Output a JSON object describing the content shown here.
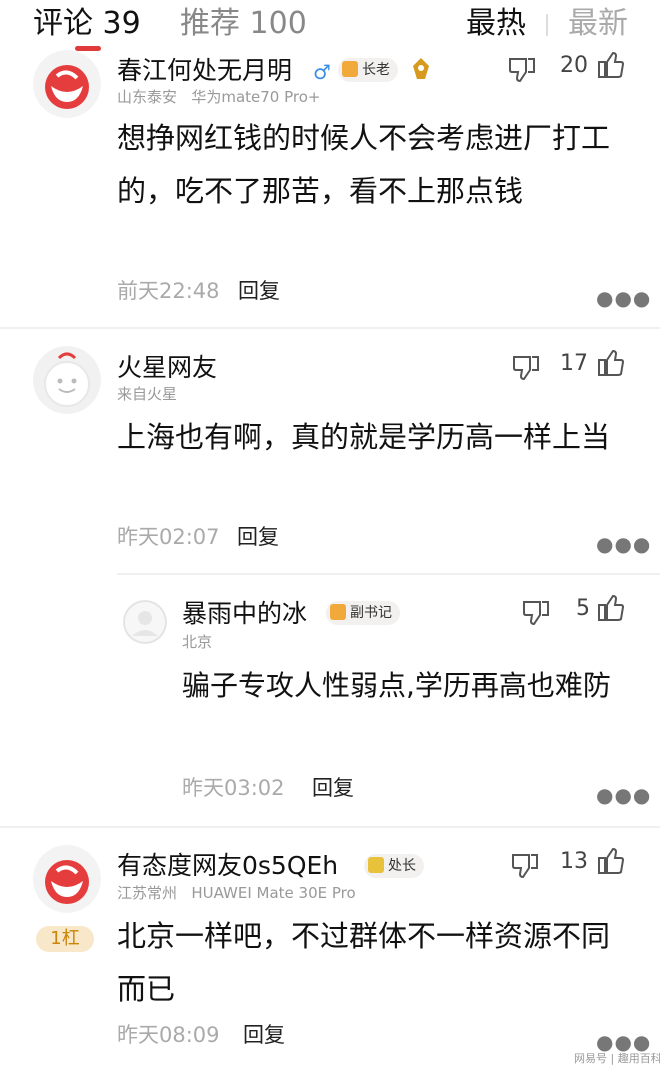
{
  "tabs": {
    "comments_label": "评论",
    "comments_count": "39",
    "recommend_label": "推荐",
    "recommend_count": "100"
  },
  "sort": {
    "hot": "最热",
    "latest": "最新"
  },
  "reply_label": "回复",
  "comments": [
    {
      "name": "春江何处无月明",
      "badge": "长老",
      "location": "山东泰安",
      "device": "华为mate70 Pro+",
      "text": "想挣网红钱的时候人不会考虑进厂打工的，吃不了那苦，看不上那点钱",
      "time": "前天22:48",
      "likes": "20"
    },
    {
      "name": "火星网友",
      "location": "来自火星",
      "text": "上海也有啊，真的就是学历高一样上当",
      "time": "昨天02:07",
      "likes": "17"
    },
    {
      "name": "暴雨中的冰",
      "badge": "副书记",
      "location": "北京",
      "text": "骗子专攻人性弱点,学历再高也难防",
      "time": "昨天03:02",
      "likes": "5"
    },
    {
      "name": "有态度网友0s5QEh",
      "badge": "处长",
      "location": "江苏常州",
      "device": "HUAWEI Mate 30E Pro",
      "rank": "1杠",
      "text": "北京一样吧，不过群体不一样资源不同而已",
      "time": "昨天08:09",
      "likes": "13"
    }
  ],
  "watermark": "网易号 | 趣用百科",
  "colors": {
    "accent": "#e03a3a",
    "badge_gold": "#f2a93b"
  }
}
